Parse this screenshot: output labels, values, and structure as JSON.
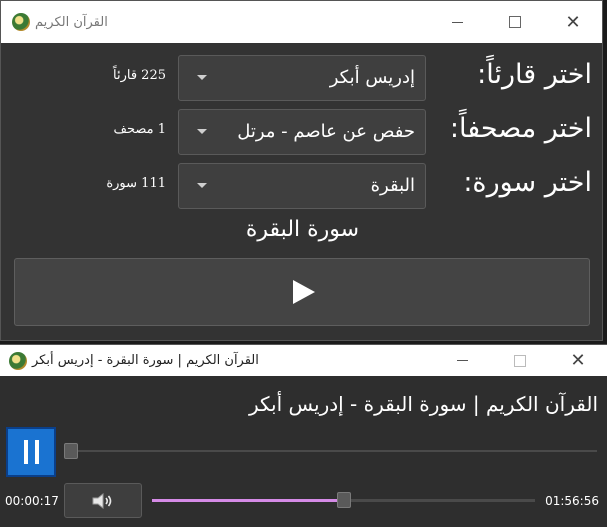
{
  "main_window": {
    "title": "القرآن الكريم",
    "reader": {
      "label": "اختر قارئاً:",
      "value": "إدريس أبكر",
      "count": "225 قارئاً"
    },
    "mushaf": {
      "label": "اختر مصحفاً:",
      "value": "حفص عن عاصم - مرتل",
      "count": "1 مصحف"
    },
    "surah": {
      "label": "اختر سورة:",
      "value": "البقرة",
      "count": "111 سورة"
    },
    "heading": "سورة البقرة",
    "play_icon": "play-icon"
  },
  "player_window": {
    "title": "القرآن الكريم | سورة البقرة - إدريس أبكر",
    "track_title": "القرآن الكريم | سورة البقرة - إدريس أبكر",
    "elapsed": "00:00:17",
    "duration": "01:56:56",
    "seek_fraction": 0.0,
    "volume_fraction": 0.5,
    "pause_icon": "pause-icon",
    "volume_icon": "speaker-icon"
  },
  "colors": {
    "accent": "#1a73d1",
    "volume_fill": "#d58be6"
  }
}
